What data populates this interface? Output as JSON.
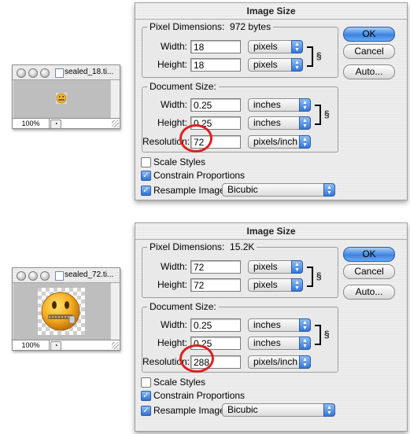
{
  "panels": [
    {
      "doc": {
        "filename": "sealed_18.ti...",
        "zoom": "100%",
        "emoji_size": "small"
      },
      "dialog": {
        "title": "Image Size",
        "pixel_dimensions_label": "Pixel Dimensions:",
        "pixel_dimensions_value": "972 bytes",
        "px_width_label": "Width:",
        "px_width": "18",
        "px_width_unit": "pixels",
        "px_height_label": "Height:",
        "px_height": "18",
        "px_height_unit": "pixels",
        "document_size_label": "Document Size:",
        "doc_width_label": "Width:",
        "doc_width": "0.25",
        "doc_width_unit": "inches",
        "doc_height_label": "Height:",
        "doc_height": "0.25",
        "doc_height_unit": "inches",
        "resolution_label": "Resolution:",
        "resolution": "72",
        "resolution_unit": "pixels/inch",
        "scale_styles": "Scale Styles",
        "scale_styles_checked": false,
        "constrain": "Constrain Proportions",
        "constrain_checked": true,
        "resample": "Resample Image:",
        "resample_checked": true,
        "resample_method": "Bicubic",
        "ok": "OK",
        "cancel": "Cancel",
        "auto": "Auto..."
      }
    },
    {
      "doc": {
        "filename": "sealed_72.ti...",
        "zoom": "100%",
        "emoji_size": "large"
      },
      "dialog": {
        "title": "Image Size",
        "pixel_dimensions_label": "Pixel Dimensions:",
        "pixel_dimensions_value": "15.2K",
        "px_width_label": "Width:",
        "px_width": "72",
        "px_width_unit": "pixels",
        "px_height_label": "Height:",
        "px_height": "72",
        "px_height_unit": "pixels",
        "document_size_label": "Document Size:",
        "doc_width_label": "Width:",
        "doc_width": "0.25",
        "doc_width_unit": "inches",
        "doc_height_label": "Height:",
        "doc_height": "0.25",
        "doc_height_unit": "inches",
        "resolution_label": "Resolution:",
        "resolution": "288",
        "resolution_unit": "pixels/inch",
        "scale_styles": "Scale Styles",
        "scale_styles_checked": false,
        "constrain": "Constrain Proportions",
        "constrain_checked": true,
        "resample": "Resample Image:",
        "resample_checked": true,
        "resample_method": "Bicubic",
        "ok": "OK",
        "cancel": "Cancel",
        "auto": "Auto..."
      }
    }
  ],
  "colors": {
    "highlight_circle": "#e01e1e",
    "ok_button": "#3c83df",
    "canvas_gray": "#bdbebd"
  }
}
